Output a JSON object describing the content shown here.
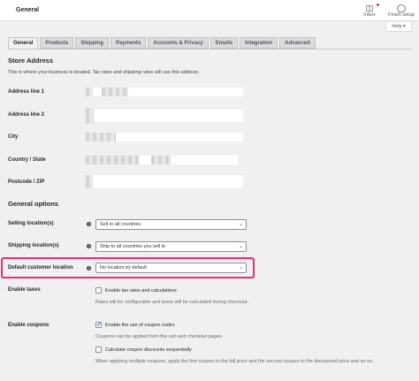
{
  "header": {
    "title": "General",
    "inbox_label": "Inbox",
    "finish_label": "Finish setup",
    "help_label": "Help ▾"
  },
  "tabs": [
    {
      "label": "General",
      "active": true
    },
    {
      "label": "Products"
    },
    {
      "label": "Shipping"
    },
    {
      "label": "Payments"
    },
    {
      "label": "Accounts & Privacy"
    },
    {
      "label": "Emails"
    },
    {
      "label": "Integration"
    },
    {
      "label": "Advanced"
    }
  ],
  "store_address": {
    "title": "Store Address",
    "description": "This is where your business is located. Tax rates and shipping rates will use this address.",
    "fields": [
      {
        "label": "Address line 1"
      },
      {
        "label": "Address line 2"
      },
      {
        "label": "City"
      },
      {
        "label": "Country / State"
      },
      {
        "label": "Postcode / ZIP"
      }
    ]
  },
  "general_options": {
    "title": "General options",
    "selling_locations": {
      "label": "Selling location(s)",
      "value": "Sell to all countries"
    },
    "shipping_locations": {
      "label": "Shipping location(s)",
      "value": "Ship to all countries you sell to"
    },
    "default_customer_location": {
      "label": "Default customer location",
      "value": "No location by default"
    },
    "enable_taxes": {
      "label": "Enable taxes",
      "checkbox_label": "Enable tax rates and calculations",
      "checked": false,
      "help": "Rates will be configurable and taxes will be calculated during checkout."
    },
    "enable_coupons": {
      "label": "Enable coupons",
      "checkbox_label": "Enable the use of coupon codes",
      "checked": true,
      "help": "Coupons can be applied from the cart and checkout pages.",
      "sequential_label": "Calculate coupon discounts sequentially",
      "sequential_checked": false,
      "sequential_help": "When applying multiple coupons, apply the first coupon to the full price and the second coupon to the discounted price and so on."
    }
  },
  "colors": {
    "highlight": "#e5307a",
    "accent": "#2271b1"
  }
}
